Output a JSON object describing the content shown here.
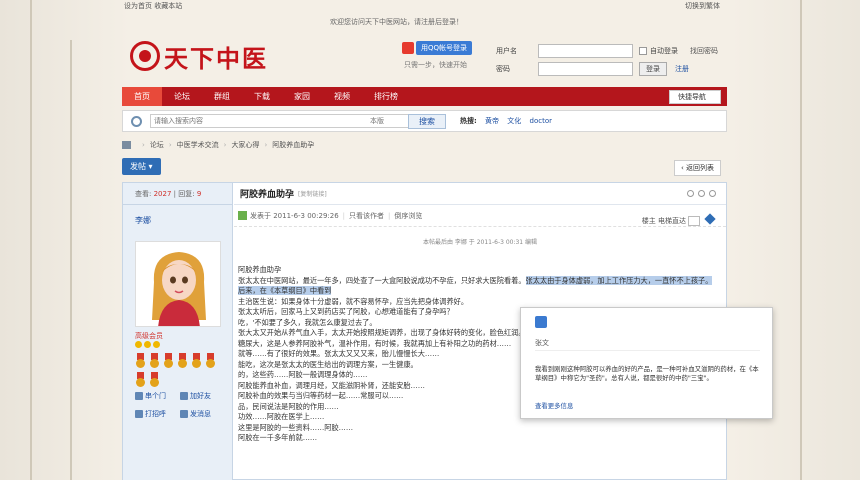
{
  "topbar": {
    "left": "设为首页  收藏本站",
    "right": "切换到繁体"
  },
  "notice": "欢迎您访问天下中医网站，请注册后登录！",
  "logo": {
    "text": "天下中医"
  },
  "qq": {
    "button": "用QQ帐号登录",
    "sub": "只需一步，快速开始"
  },
  "login": {
    "user_label": "用户名",
    "pass_label": "密码",
    "auto_login": "自动登录",
    "find_password": "找回密码",
    "login_button": "登录",
    "register": "注册"
  },
  "nav": {
    "items": [
      "首页",
      "论坛",
      "群组",
      "下载",
      "家园",
      "视频",
      "排行榜"
    ],
    "active_index": 0,
    "quick": "快捷导航"
  },
  "search": {
    "placeholder": "请输入搜索内容",
    "scope": "本版",
    "button": "搜索",
    "hot_label": "热搜:",
    "hot_terms": [
      "黄帝",
      "文化",
      "doctor"
    ]
  },
  "breadcrumb": [
    "论坛",
    "中医学术交流",
    "大家心得",
    "阿胶养血助孕"
  ],
  "post_button": "发帖",
  "back_button": "返回列表",
  "thread": {
    "views_label": "查看:",
    "views": "2027",
    "replies_label": "回复:",
    "replies": "9",
    "title": "阿胶养血助孕",
    "title_tag": "[复制链接]",
    "user": "李娜",
    "user_level": "高级会员",
    "meta": {
      "posted": "发表于 2011-6-3 00:29:26",
      "only_author": "只看该作者",
      "reverse": "倒序浏览",
      "floor": "楼主",
      "electric": "电梯直达"
    },
    "edited_note": "本帖最后由 李娜 于 2011-6-3 00:31 编辑",
    "body": [
      "阿胶养血助孕",
      "张太太在中医网站，最近一年多，四处查了一大盒阿胶说成功不孕症，只好求大医院看着。",
      "主治医生说：如果身体十分虚弱，就不容易怀孕，应当先把身体调养好。",
      "张太太听后，回家马上又到药店买了阿胶，心想难道能有了身孕吗？",
      "吃，'不如要了多久，我就怎么康复过去了。",
      "张大太又开始从养气血入手，太太开始按照规矩调养，出现了身体好转的变化，脸色红润。",
      "糖尿大，这是人参养阿胶补气，温补作用，有时候，我就再加上有补阳之功的药材……",
      "就等……有了很好的效果。张太太又又又来，胎儿慢慢长大……",
      "能吃，这次是张太太的医生给出的调理方案，一生健康。",
      "的，这些药……阿胶一般调理身体的……",
      "阿胶能养血补血，调理月经，又能滋阴补肾，还能安胎……",
      "阿胶补血的效果与当归等药材一起……常服可以……",
      "品，民间说法是阿胶的作用……",
      "功效……阿胶在医学上……",
      "这里是阿胶的一些资料……阿胶……",
      "阿胶在一千多年前就……"
    ],
    "highlight": "张太太由于身体虚弱，加上工作压力大，一直怀不上孩子。后来，在《本草纲目》中看到"
  },
  "side_actions": [
    "串个门",
    "加好友",
    "打招呼",
    "发消息"
  ],
  "popup": {
    "title": "张文",
    "text": "我看到刚刚这种阿胶可以养血的好的产品，是一种可补血又滋阴的药材，在《本草纲目》中称它为\"圣药\"。总有人说，都是很好的中药\"三宝\"。",
    "link": "查看更多信息"
  }
}
